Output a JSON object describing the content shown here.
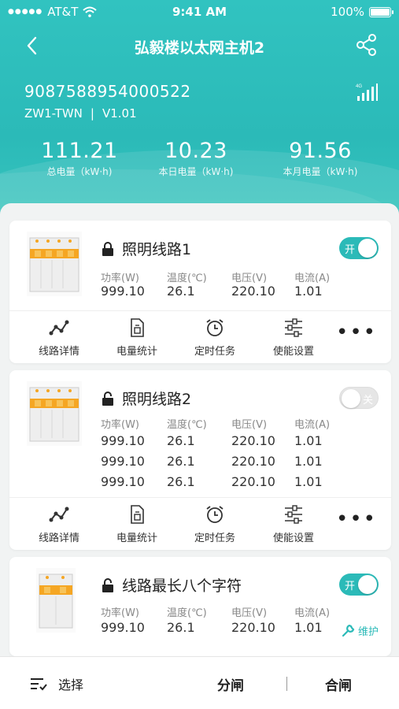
{
  "status_bar": {
    "carrier": "AT&T",
    "time": "9:41 AM",
    "battery": "100%"
  },
  "nav": {
    "title": "弘毅楼以太网主机2"
  },
  "device": {
    "id": "9087588954000522",
    "model": "ZW1-TWN",
    "separator": "|",
    "version": "V1.01",
    "signal_label": "4G"
  },
  "stats": [
    {
      "value": "111.21",
      "label": "总电量（kW·h)"
    },
    {
      "value": "10.23",
      "label": "本日电量（kW·h)"
    },
    {
      "value": "91.56",
      "label": "本月电量（kW·h)"
    }
  ],
  "metric_headers": [
    "功率(W)",
    "温度(℃)",
    "电压(V)",
    "电流(A)"
  ],
  "actions": [
    "线路详情",
    "电量统计",
    "定时任务",
    "使能设置"
  ],
  "lines": [
    {
      "name": "照明线路1",
      "locked": true,
      "switch_on": true,
      "switch_label": "开",
      "rows": [
        [
          "999.10",
          "26.1",
          "220.10",
          "1.01"
        ]
      ]
    },
    {
      "name": "照明线路2",
      "locked": false,
      "switch_on": false,
      "switch_label": "关",
      "rows": [
        [
          "999.10",
          "26.1",
          "220.10",
          "1.01"
        ],
        [
          "999.10",
          "26.1",
          "220.10",
          "1.01"
        ],
        [
          "999.10",
          "26.1",
          "220.10",
          "1.01"
        ]
      ]
    },
    {
      "name": "线路最长八个字符",
      "locked": false,
      "switch_on": true,
      "switch_label": "开",
      "rows": [
        [
          "999.10",
          "26.1",
          "220.10",
          "1.01"
        ]
      ],
      "maintenance_label": "维护"
    }
  ],
  "bottom_bar": {
    "select": "选择",
    "split": "分闸",
    "close": "合闸"
  },
  "colors": {
    "accent": "#2bbab8"
  }
}
